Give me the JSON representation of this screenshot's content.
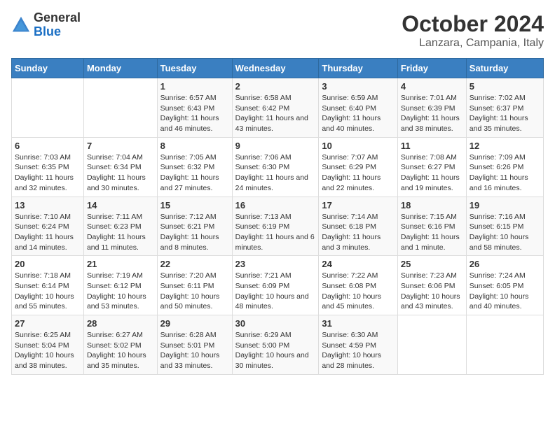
{
  "logo": {
    "general": "General",
    "blue": "Blue"
  },
  "title": "October 2024",
  "subtitle": "Lanzara, Campania, Italy",
  "headers": [
    "Sunday",
    "Monday",
    "Tuesday",
    "Wednesday",
    "Thursday",
    "Friday",
    "Saturday"
  ],
  "weeks": [
    [
      {
        "day": "",
        "info": ""
      },
      {
        "day": "",
        "info": ""
      },
      {
        "day": "1",
        "info": "Sunrise: 6:57 AM\nSunset: 6:43 PM\nDaylight: 11 hours and 46 minutes."
      },
      {
        "day": "2",
        "info": "Sunrise: 6:58 AM\nSunset: 6:42 PM\nDaylight: 11 hours and 43 minutes."
      },
      {
        "day": "3",
        "info": "Sunrise: 6:59 AM\nSunset: 6:40 PM\nDaylight: 11 hours and 40 minutes."
      },
      {
        "day": "4",
        "info": "Sunrise: 7:01 AM\nSunset: 6:39 PM\nDaylight: 11 hours and 38 minutes."
      },
      {
        "day": "5",
        "info": "Sunrise: 7:02 AM\nSunset: 6:37 PM\nDaylight: 11 hours and 35 minutes."
      }
    ],
    [
      {
        "day": "6",
        "info": "Sunrise: 7:03 AM\nSunset: 6:35 PM\nDaylight: 11 hours and 32 minutes."
      },
      {
        "day": "7",
        "info": "Sunrise: 7:04 AM\nSunset: 6:34 PM\nDaylight: 11 hours and 30 minutes."
      },
      {
        "day": "8",
        "info": "Sunrise: 7:05 AM\nSunset: 6:32 PM\nDaylight: 11 hours and 27 minutes."
      },
      {
        "day": "9",
        "info": "Sunrise: 7:06 AM\nSunset: 6:30 PM\nDaylight: 11 hours and 24 minutes."
      },
      {
        "day": "10",
        "info": "Sunrise: 7:07 AM\nSunset: 6:29 PM\nDaylight: 11 hours and 22 minutes."
      },
      {
        "day": "11",
        "info": "Sunrise: 7:08 AM\nSunset: 6:27 PM\nDaylight: 11 hours and 19 minutes."
      },
      {
        "day": "12",
        "info": "Sunrise: 7:09 AM\nSunset: 6:26 PM\nDaylight: 11 hours and 16 minutes."
      }
    ],
    [
      {
        "day": "13",
        "info": "Sunrise: 7:10 AM\nSunset: 6:24 PM\nDaylight: 11 hours and 14 minutes."
      },
      {
        "day": "14",
        "info": "Sunrise: 7:11 AM\nSunset: 6:23 PM\nDaylight: 11 hours and 11 minutes."
      },
      {
        "day": "15",
        "info": "Sunrise: 7:12 AM\nSunset: 6:21 PM\nDaylight: 11 hours and 8 minutes."
      },
      {
        "day": "16",
        "info": "Sunrise: 7:13 AM\nSunset: 6:19 PM\nDaylight: 11 hours and 6 minutes."
      },
      {
        "day": "17",
        "info": "Sunrise: 7:14 AM\nSunset: 6:18 PM\nDaylight: 11 hours and 3 minutes."
      },
      {
        "day": "18",
        "info": "Sunrise: 7:15 AM\nSunset: 6:16 PM\nDaylight: 11 hours and 1 minute."
      },
      {
        "day": "19",
        "info": "Sunrise: 7:16 AM\nSunset: 6:15 PM\nDaylight: 10 hours and 58 minutes."
      }
    ],
    [
      {
        "day": "20",
        "info": "Sunrise: 7:18 AM\nSunset: 6:14 PM\nDaylight: 10 hours and 55 minutes."
      },
      {
        "day": "21",
        "info": "Sunrise: 7:19 AM\nSunset: 6:12 PM\nDaylight: 10 hours and 53 minutes."
      },
      {
        "day": "22",
        "info": "Sunrise: 7:20 AM\nSunset: 6:11 PM\nDaylight: 10 hours and 50 minutes."
      },
      {
        "day": "23",
        "info": "Sunrise: 7:21 AM\nSunset: 6:09 PM\nDaylight: 10 hours and 48 minutes."
      },
      {
        "day": "24",
        "info": "Sunrise: 7:22 AM\nSunset: 6:08 PM\nDaylight: 10 hours and 45 minutes."
      },
      {
        "day": "25",
        "info": "Sunrise: 7:23 AM\nSunset: 6:06 PM\nDaylight: 10 hours and 43 minutes."
      },
      {
        "day": "26",
        "info": "Sunrise: 7:24 AM\nSunset: 6:05 PM\nDaylight: 10 hours and 40 minutes."
      }
    ],
    [
      {
        "day": "27",
        "info": "Sunrise: 6:25 AM\nSunset: 5:04 PM\nDaylight: 10 hours and 38 minutes."
      },
      {
        "day": "28",
        "info": "Sunrise: 6:27 AM\nSunset: 5:02 PM\nDaylight: 10 hours and 35 minutes."
      },
      {
        "day": "29",
        "info": "Sunrise: 6:28 AM\nSunset: 5:01 PM\nDaylight: 10 hours and 33 minutes."
      },
      {
        "day": "30",
        "info": "Sunrise: 6:29 AM\nSunset: 5:00 PM\nDaylight: 10 hours and 30 minutes."
      },
      {
        "day": "31",
        "info": "Sunrise: 6:30 AM\nSunset: 4:59 PM\nDaylight: 10 hours and 28 minutes."
      },
      {
        "day": "",
        "info": ""
      },
      {
        "day": "",
        "info": ""
      }
    ]
  ]
}
